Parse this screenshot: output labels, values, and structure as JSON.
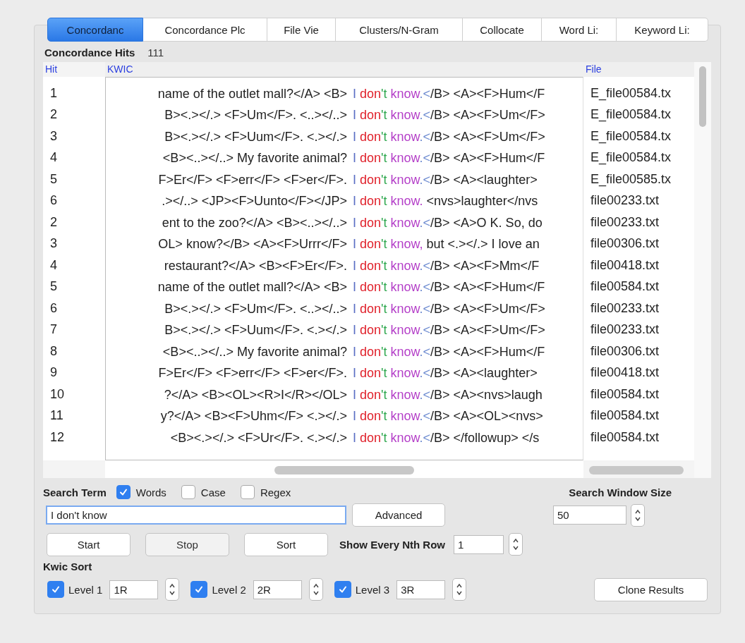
{
  "tabs": [
    {
      "label": "Concordanc",
      "selected": true
    },
    {
      "label": "Concordance Plc",
      "selected": false
    },
    {
      "label": "File Vie",
      "selected": false
    },
    {
      "label": "Clusters/N-Gram",
      "selected": false
    },
    {
      "label": "Collocate",
      "selected": false
    },
    {
      "label": "Word Li:",
      "selected": false
    },
    {
      "label": "Keyword Li:",
      "selected": false
    }
  ],
  "hits_label": "Concordance Hits",
  "hits_count": "111",
  "table": {
    "columns": [
      "Hit",
      "KWIC",
      "File"
    ],
    "rows": [
      {
        "hit": "1",
        "left": "name of the outlet mall?</A> <B>",
        "key": [
          {
            "text": "I ",
            "color": "#5b6fc4"
          },
          {
            "text": "don",
            "color": "#e0202a"
          },
          {
            "text": "'t ",
            "color": "#2fa84f"
          },
          {
            "text": "know",
            "color": "#b43fc8"
          },
          {
            "text": ".<",
            "color": "#6c8ad0"
          }
        ],
        "right": "/B> <A><F>Hum</F",
        "file": "E_file00584.tx"
      },
      {
        "hit": "2",
        "left": "B><.></.> <F>Um</F>. <..></..>",
        "key": [
          {
            "text": "I ",
            "color": "#5b6fc4"
          },
          {
            "text": "don",
            "color": "#e0202a"
          },
          {
            "text": "'t ",
            "color": "#2fa84f"
          },
          {
            "text": "know",
            "color": "#b43fc8"
          },
          {
            "text": ".<",
            "color": "#6c8ad0"
          }
        ],
        "right": "/B> <A><F>Um</F>",
        "file": "E_file00584.tx"
      },
      {
        "hit": "3",
        "left": "B><.></.> <F>Uum</F>. <.></.>",
        "key": [
          {
            "text": "I ",
            "color": "#5b6fc4"
          },
          {
            "text": "don",
            "color": "#e0202a"
          },
          {
            "text": "'t ",
            "color": "#2fa84f"
          },
          {
            "text": "know",
            "color": "#b43fc8"
          },
          {
            "text": ".<",
            "color": "#6c8ad0"
          }
        ],
        "right": "/B> <A><F>Um</F>",
        "file": "E_file00584.tx"
      },
      {
        "hit": "4",
        "left": "<B><..></..> My favorite animal?",
        "key": [
          {
            "text": "I ",
            "color": "#5b6fc4"
          },
          {
            "text": "don",
            "color": "#e0202a"
          },
          {
            "text": "'t ",
            "color": "#2fa84f"
          },
          {
            "text": "know",
            "color": "#b43fc8"
          },
          {
            "text": ".<",
            "color": "#6c8ad0"
          }
        ],
        "right": "/B> <A><F>Hum</F",
        "file": "E_file00584.tx"
      },
      {
        "hit": "5",
        "left": "F>Er</F> <F>err</F> <F>er</F>.",
        "key": [
          {
            "text": "I ",
            "color": "#5b6fc4"
          },
          {
            "text": "don",
            "color": "#e0202a"
          },
          {
            "text": "'t ",
            "color": "#2fa84f"
          },
          {
            "text": "know",
            "color": "#b43fc8"
          },
          {
            "text": ".<",
            "color": "#6c8ad0"
          }
        ],
        "right": "/B> <A><laughter>",
        "file": "E_file00585.tx"
      },
      {
        "hit": "6",
        "left": ".></..> <JP><F>Uunto</F></JP>",
        "key": [
          {
            "text": "I ",
            "color": "#5b6fc4"
          },
          {
            "text": "don",
            "color": "#e0202a"
          },
          {
            "text": "'t ",
            "color": "#2fa84f"
          },
          {
            "text": "know.",
            "color": "#b43fc8"
          }
        ],
        "right": " <nvs>laughter</nvs",
        "file": "file00233.txt"
      },
      {
        "hit": "2",
        "left": "ent to the zoo?</A> <B><..></..>",
        "key": [
          {
            "text": "I ",
            "color": "#5b6fc4"
          },
          {
            "text": "don",
            "color": "#e0202a"
          },
          {
            "text": "'t ",
            "color": "#2fa84f"
          },
          {
            "text": "know",
            "color": "#b43fc8"
          },
          {
            "text": ".<",
            "color": "#6c8ad0"
          }
        ],
        "right": "/B> <A>O K. So, do",
        "file": "file00233.txt"
      },
      {
        "hit": "3",
        "left": "OL> know?</B> <A><F>Urrr</F>",
        "key": [
          {
            "text": "I ",
            "color": "#5b6fc4"
          },
          {
            "text": "don",
            "color": "#e0202a"
          },
          {
            "text": "'t ",
            "color": "#2fa84f"
          },
          {
            "text": "know,",
            "color": "#b43fc8"
          }
        ],
        "right": " but <.></.> I love an",
        "file": "file00306.txt"
      },
      {
        "hit": "4",
        "left": "restaurant?</A> <B><F>Er</F>.",
        "key": [
          {
            "text": "I ",
            "color": "#5b6fc4"
          },
          {
            "text": "don",
            "color": "#e0202a"
          },
          {
            "text": "'t ",
            "color": "#2fa84f"
          },
          {
            "text": "know",
            "color": "#b43fc8"
          },
          {
            "text": ".<",
            "color": "#6c8ad0"
          }
        ],
        "right": "/B> <A><F>Mm</F",
        "file": "file00418.txt"
      },
      {
        "hit": "5",
        "left": "name of the outlet mall?</A> <B>",
        "key": [
          {
            "text": "I ",
            "color": "#5b6fc4"
          },
          {
            "text": "don",
            "color": "#e0202a"
          },
          {
            "text": "'t ",
            "color": "#2fa84f"
          },
          {
            "text": "know",
            "color": "#b43fc8"
          },
          {
            "text": ".<",
            "color": "#6c8ad0"
          }
        ],
        "right": "/B> <A><F>Hum</F",
        "file": "file00584.txt"
      },
      {
        "hit": "6",
        "left": "B><.></.> <F>Um</F>. <..></..>",
        "key": [
          {
            "text": "I ",
            "color": "#5b6fc4"
          },
          {
            "text": "don",
            "color": "#e0202a"
          },
          {
            "text": "'t ",
            "color": "#2fa84f"
          },
          {
            "text": "know",
            "color": "#b43fc8"
          },
          {
            "text": ".<",
            "color": "#6c8ad0"
          }
        ],
        "right": "/B> <A><F>Um</F>",
        "file": "file00233.txt"
      },
      {
        "hit": "7",
        "left": "B><.></.> <F>Uum</F>. <.></.>",
        "key": [
          {
            "text": "I ",
            "color": "#5b6fc4"
          },
          {
            "text": "don",
            "color": "#e0202a"
          },
          {
            "text": "'t ",
            "color": "#2fa84f"
          },
          {
            "text": "know",
            "color": "#b43fc8"
          },
          {
            "text": ".<",
            "color": "#6c8ad0"
          }
        ],
        "right": "/B> <A><F>Um</F>",
        "file": "file00233.txt"
      },
      {
        "hit": "8",
        "left": "<B><..></..> My favorite animal?",
        "key": [
          {
            "text": "I ",
            "color": "#5b6fc4"
          },
          {
            "text": "don",
            "color": "#e0202a"
          },
          {
            "text": "'t ",
            "color": "#2fa84f"
          },
          {
            "text": "know",
            "color": "#b43fc8"
          },
          {
            "text": ".<",
            "color": "#6c8ad0"
          }
        ],
        "right": "/B> <A><F>Hum</F",
        "file": "file00306.txt"
      },
      {
        "hit": "9",
        "left": "F>Er</F> <F>err</F> <F>er</F>.",
        "key": [
          {
            "text": "I ",
            "color": "#5b6fc4"
          },
          {
            "text": "don",
            "color": "#e0202a"
          },
          {
            "text": "'t ",
            "color": "#2fa84f"
          },
          {
            "text": "know",
            "color": "#b43fc8"
          },
          {
            "text": ".<",
            "color": "#6c8ad0"
          }
        ],
        "right": "/B> <A><laughter>",
        "file": "file00418.txt"
      },
      {
        "hit": "10",
        "left": "?</A> <B><OL><R>I</R></OL>",
        "key": [
          {
            "text": "I ",
            "color": "#5b6fc4"
          },
          {
            "text": "don",
            "color": "#e0202a"
          },
          {
            "text": "'t ",
            "color": "#2fa84f"
          },
          {
            "text": "know",
            "color": "#b43fc8"
          },
          {
            "text": ".<",
            "color": "#6c8ad0"
          }
        ],
        "right": "/B> <A><nvs>laugh",
        "file": "file00584.txt"
      },
      {
        "hit": "11",
        "left": "y?</A> <B><F>Uhm</F> <.></.>",
        "key": [
          {
            "text": "I ",
            "color": "#5b6fc4"
          },
          {
            "text": "don",
            "color": "#e0202a"
          },
          {
            "text": "'t ",
            "color": "#2fa84f"
          },
          {
            "text": "know",
            "color": "#b43fc8"
          },
          {
            "text": ".<",
            "color": "#6c8ad0"
          }
        ],
        "right": "/B> <A><OL><nvs>",
        "file": "file00584.txt"
      },
      {
        "hit": "12",
        "left": "<B><.></.> <F>Ur</F>. <.></.>",
        "key": [
          {
            "text": "I ",
            "color": "#5b6fc4"
          },
          {
            "text": "don",
            "color": "#e0202a"
          },
          {
            "text": "'t ",
            "color": "#2fa84f"
          },
          {
            "text": "know",
            "color": "#b43fc8"
          },
          {
            "text": ".<",
            "color": "#6c8ad0"
          }
        ],
        "right": "/B> </followup> </s",
        "file": "file00584.txt"
      }
    ]
  },
  "search": {
    "label": "Search Term",
    "options": [
      {
        "label": "Words",
        "checked": true
      },
      {
        "label": "Case",
        "checked": false
      },
      {
        "label": "Regex",
        "checked": false
      }
    ],
    "value": "I don't know",
    "advanced": "Advanced"
  },
  "window_size": {
    "label": "Search Window Size",
    "value": "50"
  },
  "buttons": [
    {
      "label": "Start",
      "disabled": false
    },
    {
      "label": "Stop",
      "disabled": true
    },
    {
      "label": "Sort",
      "disabled": false
    }
  ],
  "nth_row": {
    "label": "Show Every Nth Row",
    "value": "1"
  },
  "kwic_sort": {
    "label": "Kwic Sort",
    "levels": [
      {
        "label": "Level 1",
        "checked": true,
        "value": "1R"
      },
      {
        "label": "Level 2",
        "checked": true,
        "value": "2R"
      },
      {
        "label": "Level 3",
        "checked": true,
        "value": "3R"
      }
    ]
  },
  "clone_button": "Clone Results"
}
